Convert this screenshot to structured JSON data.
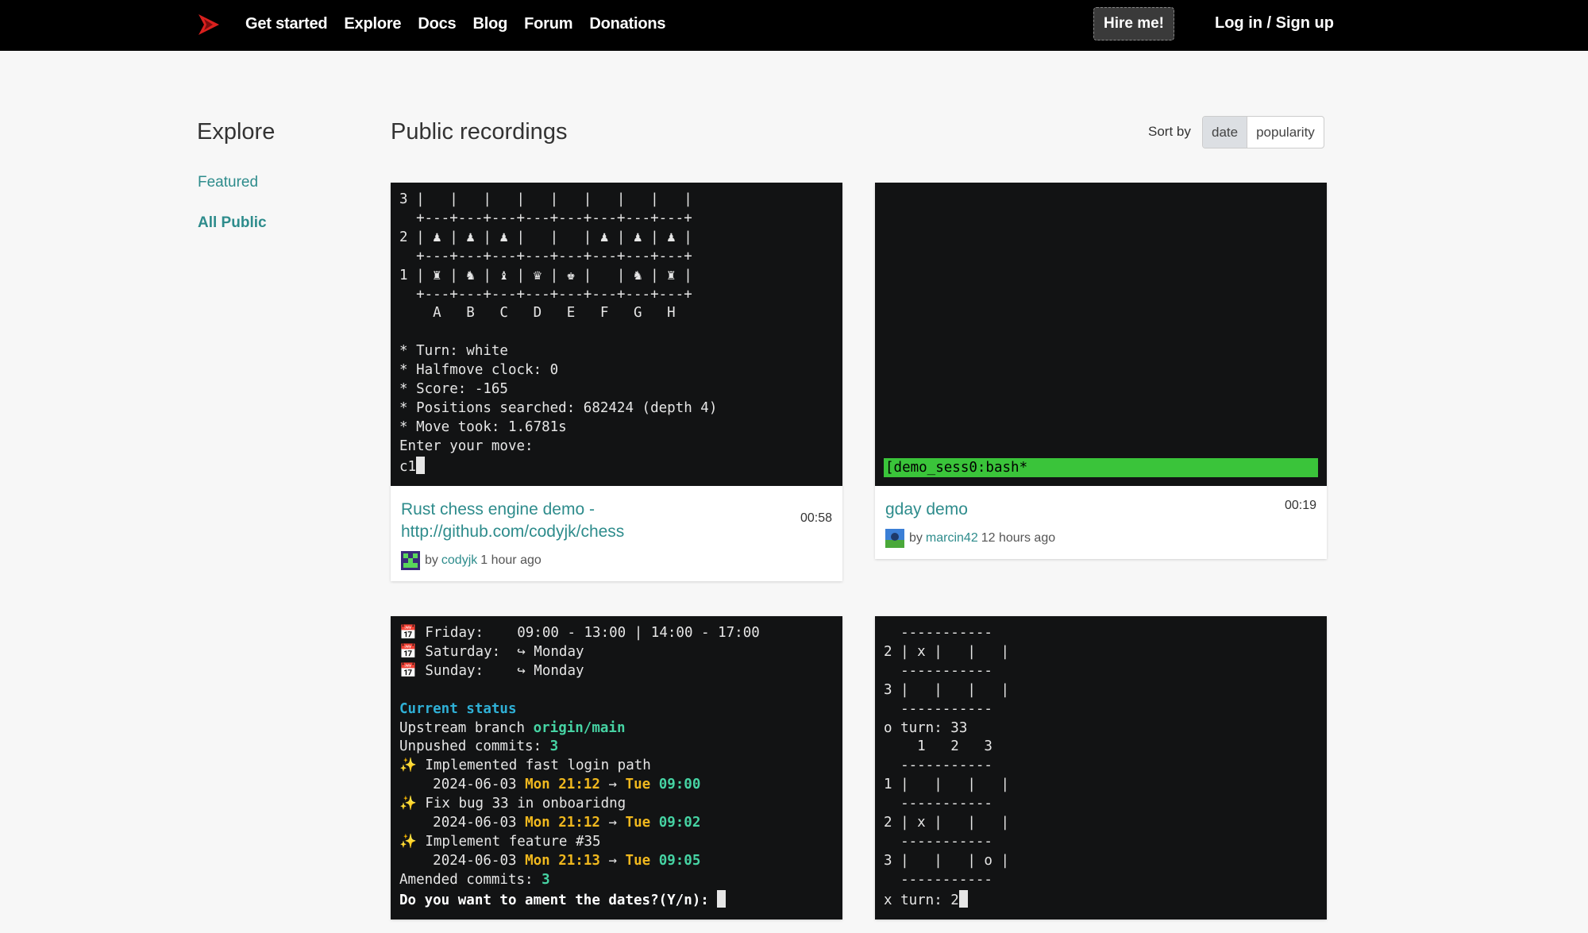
{
  "nav": {
    "links": [
      "Get started",
      "Explore",
      "Docs",
      "Blog",
      "Forum",
      "Donations"
    ],
    "hire": "Hire me!",
    "login": "Log in / Sign up"
  },
  "sidebar": {
    "title": "Explore",
    "items": [
      "Featured",
      "All Public"
    ]
  },
  "main": {
    "title": "Public recordings",
    "sort_label": "Sort by",
    "sort_options": [
      "date",
      "popularity"
    ]
  },
  "cards": [
    {
      "title": "Rust chess engine demo - http://github.com/codyjk/chess",
      "duration": "00:58",
      "by": "by",
      "user": "codyjk",
      "time": "1 hour ago",
      "term": [
        "3 |   |   |   |   |   |   |   |   |",
        "  +---+---+---+---+---+---+---+---+",
        "2 | ♟ | ♟ | ♟ |   |   | ♟ | ♟ | ♟ |",
        "  +---+---+---+---+---+---+---+---+",
        "1 | ♜ | ♞ | ♝ | ♛ | ♚ |   | ♞ | ♜ |",
        "  +---+---+---+---+---+---+---+---+",
        "    A   B   C   D   E   F   G   H",
        "",
        "* Turn: white",
        "* Halfmove clock: 0",
        "* Score: -165",
        "* Positions searched: 682424 (depth 4)",
        "* Move took: 1.6781s",
        "Enter your move:"
      ],
      "prompt": "c1"
    },
    {
      "title": "gday demo",
      "duration": "00:19",
      "by": "by",
      "user": "marcin42",
      "time": "12 hours ago",
      "status_bar": "[demo_sess0:bash*"
    },
    {
      "lines": {
        "fri_label": "📅 Friday:",
        "fri_val": "09:00 - 13:00 | 14:00 - 17:00",
        "sat_label": "📅 Saturday:",
        "sat_val": "↪ Monday",
        "sun_label": "📅 Sunday:",
        "sun_val": "↪ Monday",
        "status_title": "Current status",
        "upstream_label": "Upstream branch",
        "upstream_val": "origin/main",
        "unpushed_label": "Unpushed commits:",
        "unpushed_val": "3",
        "commit1": "Implemented fast login path",
        "commit2": "Fix bug 33 in onboaridng",
        "commit3": "Implement feature #35",
        "date": "2024-06-03",
        "mon": "Mon",
        "tue": "Tue",
        "t1a": "21:12",
        "t1b": "09:00",
        "t2a": "21:12",
        "t2b": "09:02",
        "t3a": "21:13",
        "t3b": "09:05",
        "arrow": "→",
        "amended_label": "Amended commits:",
        "amended_val": "3",
        "question": "Do you want to ament the dates?(Y/n):"
      }
    },
    {
      "term": [
        "  -----------",
        "2 | x |   |   |",
        "  -----------",
        "3 |   |   |   |",
        "  -----------",
        "o turn: 33",
        "    1   2   3",
        "  -----------",
        "1 |   |   |   |",
        "  -----------",
        "2 | x |   |   |",
        "  -----------",
        "3 |   |   | o |",
        "  -----------"
      ],
      "prompt": "x turn: 2"
    }
  ],
  "colors": {
    "accent": "#2e8c8c",
    "navbar": "#000000",
    "logo": "#d9201e",
    "terminal_bg": "#121314",
    "tmux_green": "#3ac43a"
  }
}
